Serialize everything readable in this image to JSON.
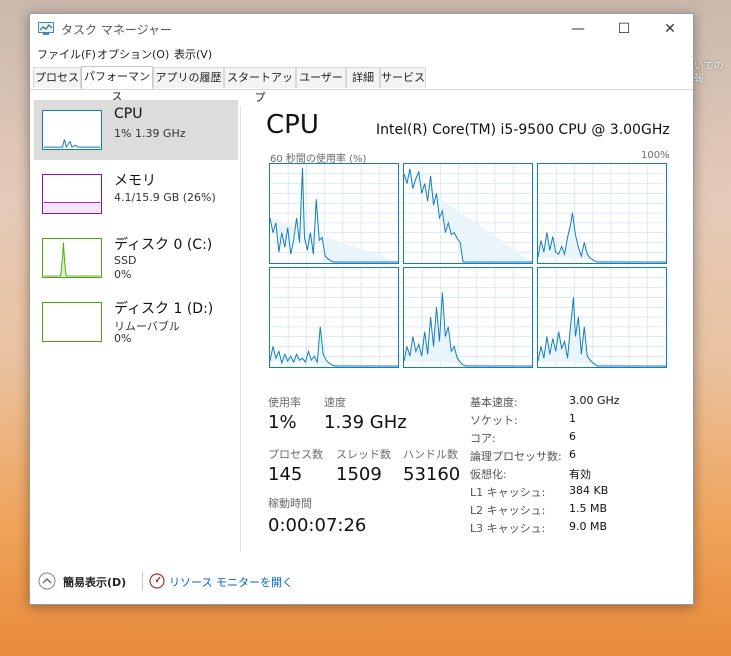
{
  "desktop": {
    "snippet_line1": "いての",
    "snippet_line2": "報"
  },
  "window": {
    "title": "タスク マネージャー",
    "controls": {
      "minimize": "—",
      "maximize": "☐",
      "close": "✕"
    }
  },
  "menu": [
    "ファイル(F)",
    "オプション(O)",
    "表示(V)"
  ],
  "tabs": [
    "プロセス",
    "パフォーマンス",
    "アプリの履歴",
    "スタートアップ",
    "ユーザー",
    "詳細",
    "サービス"
  ],
  "active_tab": "パフォーマンス",
  "sidebar": {
    "items": [
      {
        "name": "CPU",
        "sub1": "1%  1.39 GHz",
        "sub2": "",
        "color": "#117dbb"
      },
      {
        "name": "メモリ",
        "sub1": "4.1/15.9 GB (26%)",
        "sub2": "",
        "color": "#8b12ae"
      },
      {
        "name": "ディスク 0 (C:)",
        "sub1": "SSD",
        "sub2": "0%",
        "color": "#4da60c"
      },
      {
        "name": "ディスク 1 (D:)",
        "sub1": "リムーバブル",
        "sub2": "0%",
        "color": "#4da60c"
      }
    ]
  },
  "cpu": {
    "title": "CPU",
    "model": "Intel(R) Core(TM) i5-9500 CPU @ 3.00GHz",
    "graph_caption": "60 秒間の使用率 (%)",
    "graph_max": "100%",
    "stats": {
      "usage_label": "使用率",
      "usage_value": "1%",
      "speed_label": "速度",
      "speed_value": "1.39 GHz",
      "processes_label": "プロセス数",
      "processes_value": "145",
      "threads_label": "スレッド数",
      "threads_value": "1509",
      "handles_label": "ハンドル数",
      "handles_value": "53160",
      "uptime_label": "稼動時間",
      "uptime_value": "0:00:07:26"
    },
    "details": [
      {
        "label": "基本速度:",
        "value": "3.00 GHz"
      },
      {
        "label": "ソケット:",
        "value": "1"
      },
      {
        "label": "コア:",
        "value": "6"
      },
      {
        "label": "論理プロセッサ数:",
        "value": "6"
      },
      {
        "label": "仮想化:",
        "value": "有効"
      },
      {
        "label": "L1 キャッシュ:",
        "value": "384 KB"
      },
      {
        "label": "L2 キャッシュ:",
        "value": "1.5 MB"
      },
      {
        "label": "L3 キャッシュ:",
        "value": "9.0 MB"
      }
    ]
  },
  "footer": {
    "fewer_details": "簡易表示(D)",
    "resource_monitor": "リソース モニターを開く"
  },
  "colors": {
    "cpu_line": "#117dbb",
    "cpu_grid": "#d9eaf4",
    "memory": "#8b12ae",
    "disk": "#4da60c"
  }
}
